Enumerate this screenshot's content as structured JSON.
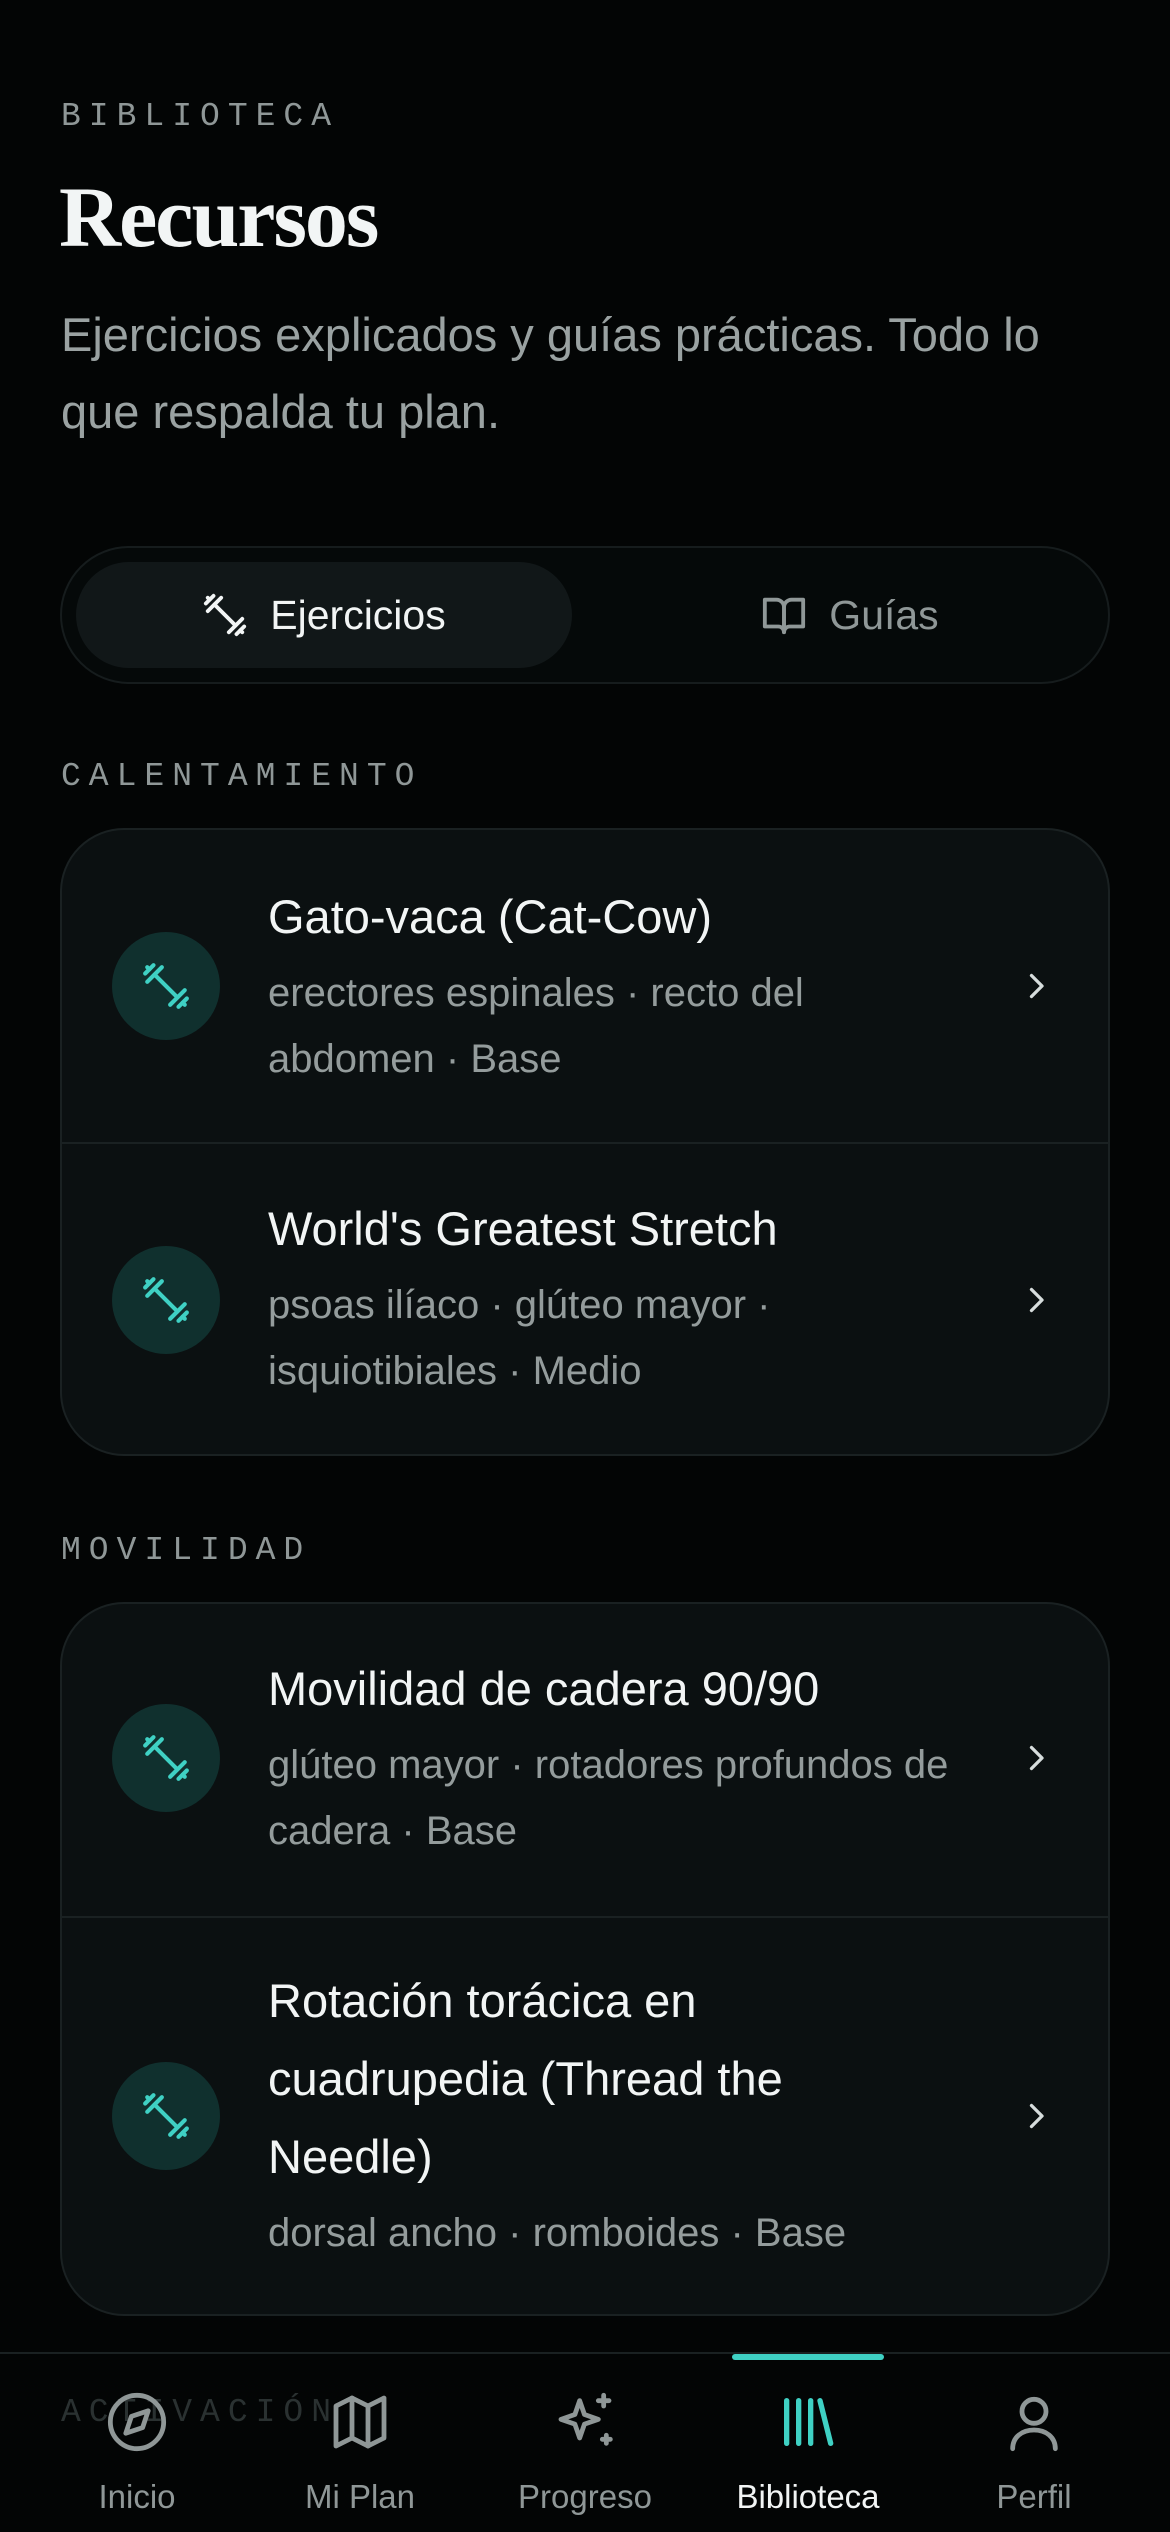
{
  "header": {
    "eyebrow": "BIBLIOTECA",
    "title": "Recursos",
    "subtitle": "Ejercicios explicados y guías prácticas. Todo lo que respalda tu plan."
  },
  "segmented": {
    "exercises_label": "Ejercicios",
    "guides_label": "Guías",
    "selected": "Ejercicios"
  },
  "sections": {
    "warmup": {
      "label": "CALENTAMIENTO",
      "items": [
        {
          "title": "Gato-vaca (Cat-Cow)",
          "meta": "erectores espinales · recto del abdomen · Base"
        },
        {
          "title": "World's Greatest Stretch",
          "meta": "psoas ilíaco · glúteo mayor · isquiotibiales · Medio"
        }
      ]
    },
    "mobility": {
      "label": "MOVILIDAD",
      "items": [
        {
          "title": "Movilidad de cadera 90/90",
          "meta": "glúteo mayor · rotadores profundos de cadera · Base"
        },
        {
          "title": "Rotación torácica en cuadrupedia (Thread the Needle)",
          "meta": "dorsal ancho · romboides · Base"
        }
      ]
    },
    "next_peek": "ACTIVACIÓN"
  },
  "tabbar": {
    "tabs": [
      {
        "label": "Inicio",
        "icon": "compass-icon"
      },
      {
        "label": "Mi Plan",
        "icon": "map-icon"
      },
      {
        "label": "Progreso",
        "icon": "sparkles-icon"
      },
      {
        "label": "Biblioteca",
        "icon": "library-icon"
      },
      {
        "label": "Perfil",
        "icon": "user-icon"
      }
    ],
    "active": "Biblioteca"
  },
  "colors": {
    "background": "#030505",
    "card": "#0b1011",
    "accent": "#3fd1c4",
    "icon_circle": "#10302e",
    "text_primary": "#f2f5f5",
    "text_secondary": "#949c9c"
  }
}
